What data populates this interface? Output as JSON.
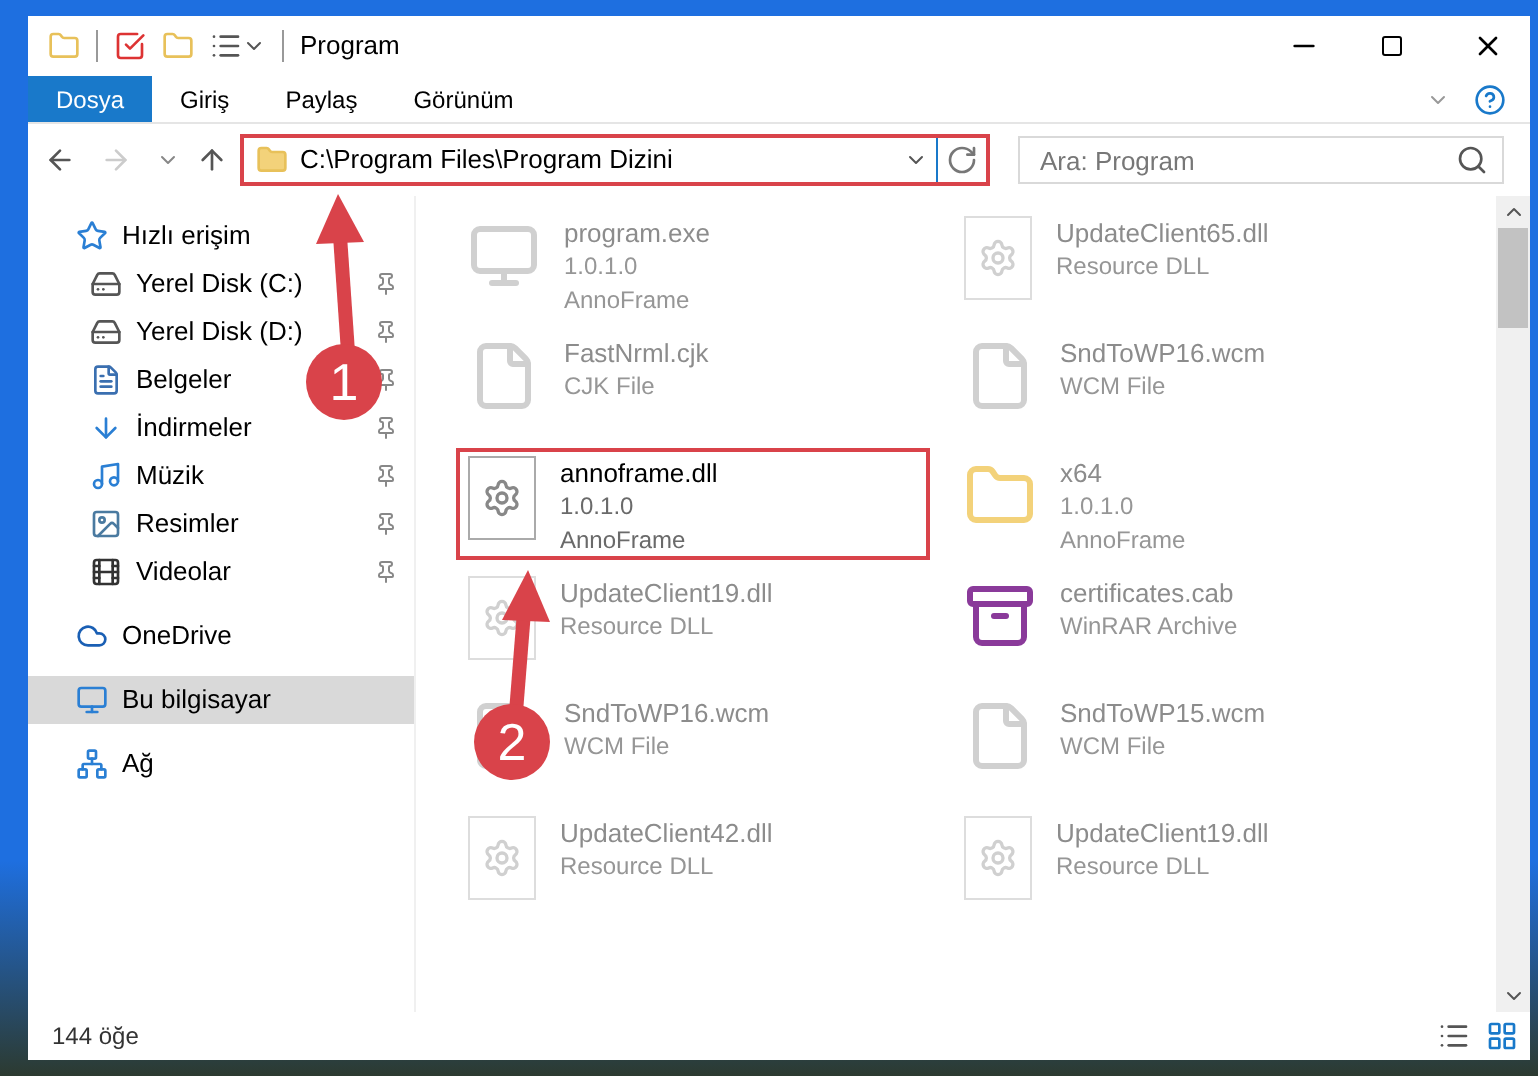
{
  "window": {
    "title": "Program"
  },
  "ribbon": {
    "tabs": [
      {
        "label": "Dosya",
        "selected": true
      },
      {
        "label": "Giriş",
        "selected": false
      },
      {
        "label": "Paylaş",
        "selected": false
      },
      {
        "label": "Görünüm",
        "selected": false
      }
    ]
  },
  "address_bar": {
    "path": "C:\\Program Files\\Program Dizini",
    "highlighted": true
  },
  "search": {
    "placeholder": "Ara: Program"
  },
  "sidebar": {
    "items": [
      {
        "label": "Hızlı erişim",
        "kind": "quick",
        "selected": false,
        "children": [
          {
            "label": "Yerel Disk (C:)",
            "kind": "drive-c",
            "pinned": true
          },
          {
            "label": "Yerel Disk (D:)",
            "kind": "drive",
            "pinned": true
          },
          {
            "label": "Belgeler",
            "kind": "docs",
            "pinned": true
          },
          {
            "label": "İndirmeler",
            "kind": "downloads",
            "pinned": true
          },
          {
            "label": "Müzik",
            "kind": "music",
            "pinned": true
          },
          {
            "label": "Resimler",
            "kind": "pictures",
            "pinned": true
          },
          {
            "label": "Videolar",
            "kind": "videos",
            "pinned": true
          }
        ]
      },
      {
        "label": "OneDrive",
        "kind": "cloud",
        "selected": false
      },
      {
        "label": "Bu bilgisayar",
        "kind": "pc",
        "selected": true
      },
      {
        "label": "Ağ",
        "kind": "network",
        "selected": false
      }
    ]
  },
  "files": [
    {
      "name": "program.exe",
      "lines": [
        "1.0.1.0",
        "AnnoFrame"
      ],
      "kind": "exe",
      "dimmed": true,
      "highlighted": false
    },
    {
      "name": "UpdateClient65.dll",
      "lines": [
        "Resource DLL"
      ],
      "kind": "dll",
      "dimmed": true,
      "highlighted": false
    },
    {
      "name": "FastNrml.cjk",
      "lines": [
        "CJK File"
      ],
      "kind": "file",
      "dimmed": true,
      "highlighted": false
    },
    {
      "name": "SndToWP16.wcm",
      "lines": [
        "WCM File"
      ],
      "kind": "file",
      "dimmed": true,
      "highlighted": false
    },
    {
      "name": "annoframe.dll",
      "lines": [
        "1.0.1.0",
        "AnnoFrame"
      ],
      "kind": "dll",
      "dimmed": false,
      "highlighted": true
    },
    {
      "name": "x64",
      "lines": [
        "1.0.1.0",
        "AnnoFrame"
      ],
      "kind": "folder",
      "dimmed": true,
      "highlighted": false
    },
    {
      "name": "UpdateClient19.dll",
      "lines": [
        "Resource DLL"
      ],
      "kind": "dll",
      "dimmed": true,
      "highlighted": false
    },
    {
      "name": "certificates.cab",
      "lines": [
        "WinRAR Archive"
      ],
      "kind": "archive",
      "dimmed": true,
      "highlighted": false
    },
    {
      "name": "SndToWP16.wcm",
      "lines": [
        "WCM File"
      ],
      "kind": "file",
      "dimmed": true,
      "highlighted": false
    },
    {
      "name": "SndToWP15.wcm",
      "lines": [
        "WCM File"
      ],
      "kind": "file",
      "dimmed": true,
      "highlighted": false
    },
    {
      "name": "UpdateClient42.dll",
      "lines": [
        "Resource DLL"
      ],
      "kind": "dll",
      "dimmed": true,
      "highlighted": false
    },
    {
      "name": "UpdateClient19.dll",
      "lines": [
        "Resource DLL"
      ],
      "kind": "dll",
      "dimmed": true,
      "highlighted": false
    }
  ],
  "status_bar": {
    "count": "144 öğe"
  },
  "annotations": [
    {
      "label": "1"
    },
    {
      "label": "2"
    }
  ]
}
